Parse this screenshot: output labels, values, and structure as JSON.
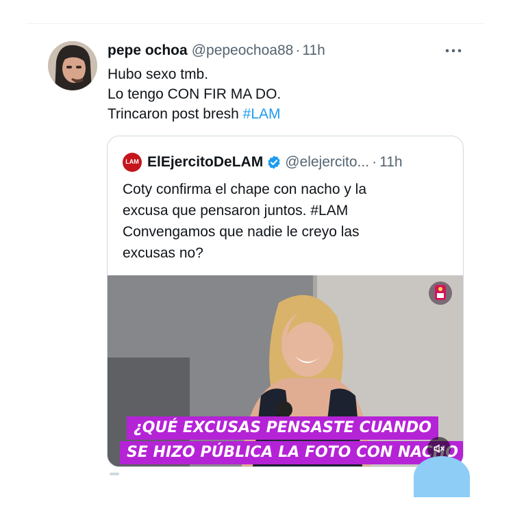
{
  "tweet": {
    "author_name": "pepe ochoa",
    "author_handle": "@pepeochoa88",
    "separator": "·",
    "time": "11h",
    "more_icon": "more-horizontal-icon",
    "lines": [
      "Hubo sexo tmb.",
      "Lo tengo CON FIR MA DO.",
      "Trincaron post bresh "
    ],
    "hashtag": "#LAM"
  },
  "quote": {
    "author_name": "ElEjercitoDeLAM",
    "avatar_text": "LAM",
    "verified_icon": "verified-badge-icon",
    "author_handle": "@elejercito...",
    "separator": "·",
    "time": "11h",
    "lines": [
      "Coty confirma el chape con nacho y la",
      "excusa que pensaron juntos. #LAM",
      "Convengamos que nadie le creyo las",
      "excusas no?"
    ],
    "video": {
      "caption_line1": "¿QUÉ EXCUSAS PENSASTE CUANDO",
      "caption_line2": "SE HIZO PÚBLICA LA FOTO CON NACHO",
      "mute_icon": "volume-muted-icon",
      "watermark_icon": "channel-logo-icon"
    }
  },
  "colors": {
    "link": "#1d9bf0",
    "secondary_text": "#536471",
    "caption_bg": "#b523d6",
    "verified": "#1d9bf0"
  }
}
